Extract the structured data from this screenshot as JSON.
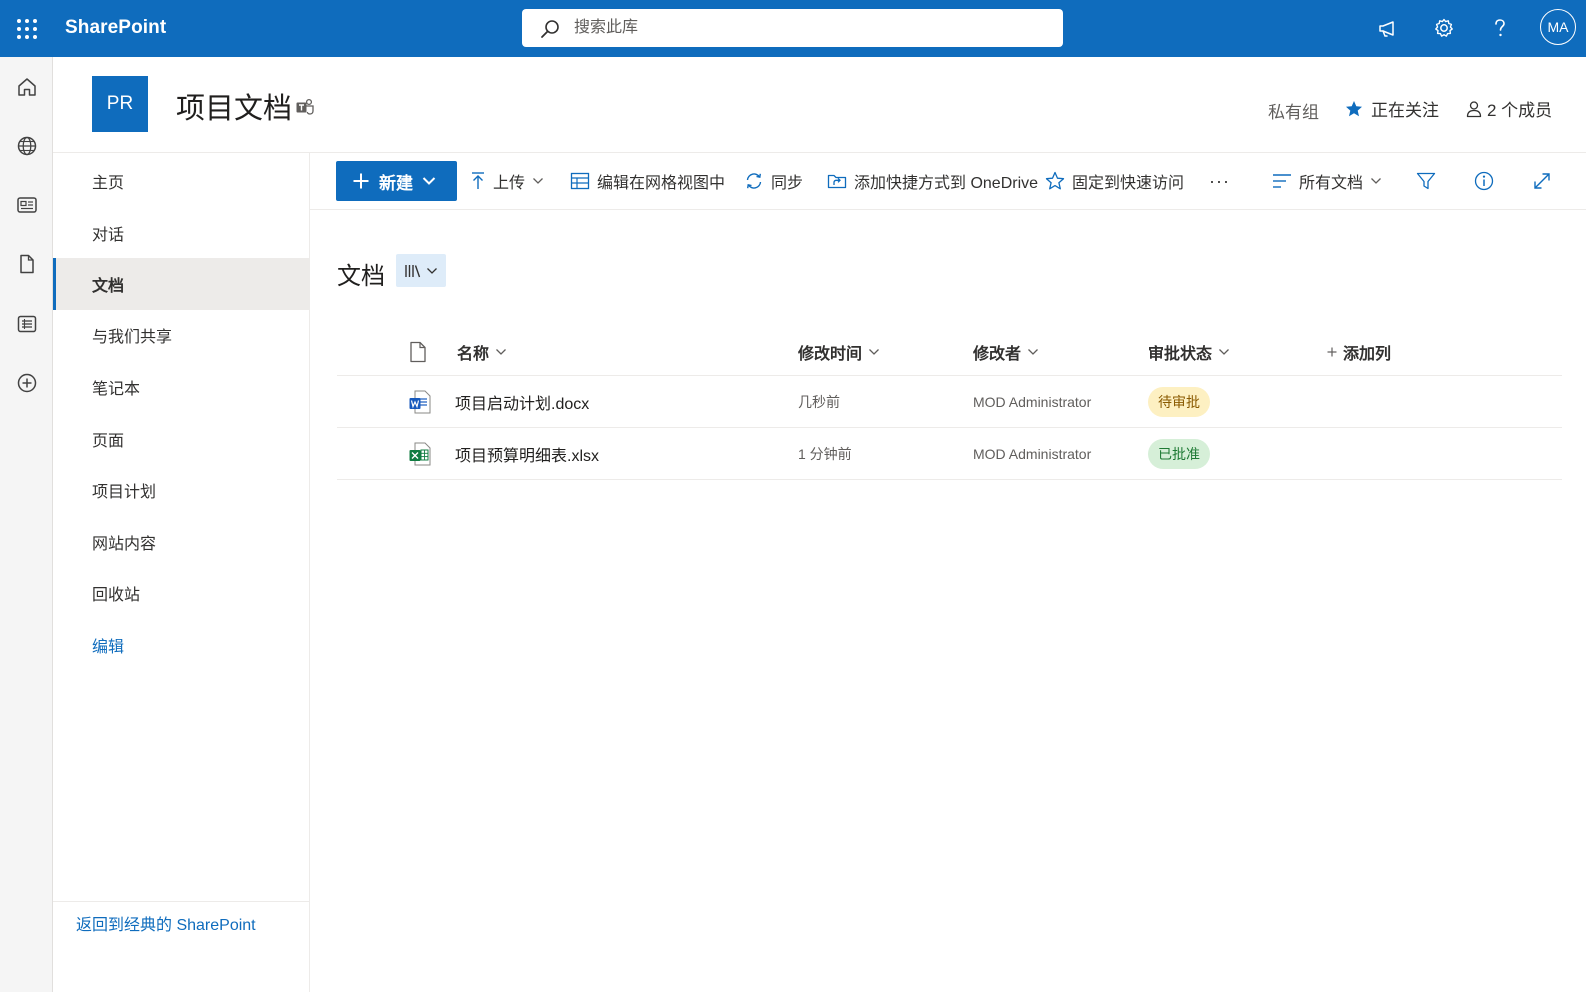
{
  "suite": {
    "brand": "SharePoint",
    "search_placeholder": "搜索此库",
    "avatar_initials": "MA"
  },
  "site": {
    "logo_initials": "PR",
    "title": "项目文档",
    "group_type": "私有组",
    "follow_label": "正在关注",
    "members_label": "2 个成员"
  },
  "nav": {
    "items": [
      {
        "label": "主页"
      },
      {
        "label": "对话"
      },
      {
        "label": "文档",
        "selected": true
      },
      {
        "label": "与我们共享"
      },
      {
        "label": "笔记本"
      },
      {
        "label": "页面"
      },
      {
        "label": "项目计划"
      },
      {
        "label": "网站内容"
      },
      {
        "label": "回收站"
      }
    ],
    "edit_label": "编辑",
    "classic_link": "返回到经典的 SharePoint"
  },
  "command_bar": {
    "new_label": "新建",
    "upload_label": "上传",
    "grid_edit_label": "编辑在网格视图中",
    "sync_label": "同步",
    "shortcut_label": "添加快捷方式到 OneDrive",
    "pin_label": "固定到快速访问",
    "more_label": "···",
    "view_label": "所有文档"
  },
  "library": {
    "title": "文档",
    "columns": {
      "name": "名称",
      "modified": "修改时间",
      "modified_by": "修改者",
      "approval": "审批状态",
      "add_column": "添加列"
    },
    "rows": [
      {
        "file_type": "word",
        "name": "项目启动计划.docx",
        "modified": "几秒前",
        "modified_by": "MOD Administrator",
        "status": "待审批"
      },
      {
        "file_type": "excel",
        "name": "项目预算明细表.xlsx",
        "modified": "1 分钟前",
        "modified_by": "MOD Administrator",
        "status": "已批准"
      }
    ]
  },
  "colors": {
    "brand_blue": "#0f6cbd",
    "pending_bg": "#fdf0c2",
    "pending_text": "#8a5a00",
    "approved_bg": "#d6efd8",
    "approved_text": "#1e7a34",
    "word_blue": "#185abd",
    "excel_green": "#107c41"
  },
  "icons": [
    "waffle-icon",
    "search-icon",
    "megaphone-icon",
    "settings-gear-icon",
    "help-icon",
    "home-icon",
    "globe-icon",
    "news-icon",
    "file-icon",
    "lists-icon",
    "create-plus-icon",
    "teams-icon",
    "star-icon",
    "person-icon",
    "plus-icon",
    "chevron-down-icon",
    "upload-arrow-icon",
    "grid-icon",
    "sync-icon",
    "onedrive-shortcut-icon",
    "pin-star-icon",
    "view-lines-icon",
    "filter-icon",
    "info-icon",
    "expand-icon",
    "library-icon",
    "document-header-icon",
    "word-file-icon",
    "excel-file-icon"
  ]
}
